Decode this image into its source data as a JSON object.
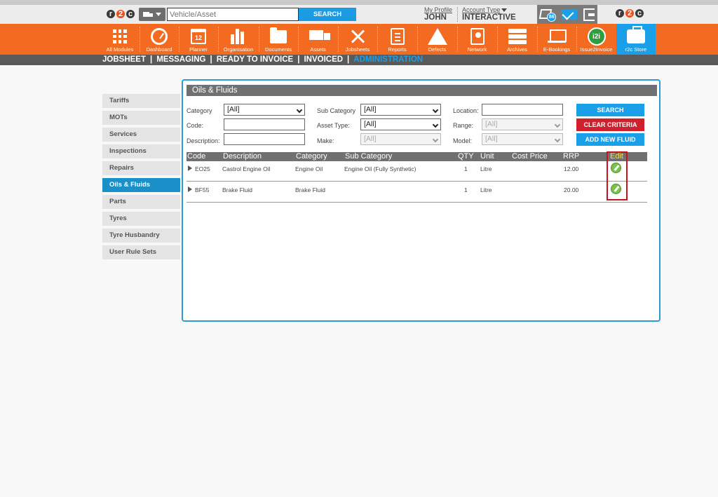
{
  "topbar": {
    "search_placeholder": "Vehicle/Asset",
    "search_button": "SEARCH",
    "my_profile_label": "My Profile",
    "user_name": "JOHN",
    "account_type_label": "Account Type",
    "account_type_value": "INTERACTIVE",
    "notification_count": "86",
    "logo_letters": [
      "r",
      "2",
      "c"
    ]
  },
  "nav": {
    "items": [
      {
        "label": "All Modules",
        "icon": "grid-icon"
      },
      {
        "label": "Dashboard",
        "icon": "speedometer-icon"
      },
      {
        "label": "Planner",
        "icon": "calendar-icon",
        "glyph_text": "12"
      },
      {
        "label": "Organisation",
        "icon": "building-icon"
      },
      {
        "label": "Documents",
        "icon": "folder-icon"
      },
      {
        "label": "Assets",
        "icon": "truck-icon"
      },
      {
        "label": "Jobsheets",
        "icon": "tools-icon"
      },
      {
        "label": "Reports",
        "icon": "clipboard-icon"
      },
      {
        "label": "Defects",
        "icon": "warning-icon"
      },
      {
        "label": "Network",
        "icon": "address-book-icon"
      },
      {
        "label": "Archives",
        "icon": "archive-icon"
      },
      {
        "label": "E-Bookings",
        "icon": "laptop-icon"
      },
      {
        "label": "Issue2Invoice",
        "icon": "i2i-icon",
        "glyph_text": "i2i"
      },
      {
        "label": "r2c Store",
        "icon": "briefcase-icon"
      }
    ]
  },
  "subnav": {
    "items": [
      "JOBSHEET",
      "MESSAGING",
      "READY TO INVOICE",
      "INVOICED",
      "ADMINISTRATION"
    ],
    "separator": "|",
    "active": "ADMINISTRATION"
  },
  "sidebar": {
    "items": [
      "Tariffs",
      "MOTs",
      "Services",
      "Inspections",
      "Repairs",
      "Oils & Fluids",
      "Parts",
      "Tyres",
      "Tyre Husbandry",
      "User Rule Sets"
    ],
    "active": "Oils & Fluids"
  },
  "panel": {
    "title": "Oils & Fluids",
    "filters": {
      "category_label": "Category",
      "category_value": "[All]",
      "sub_category_label": "Sub Category",
      "sub_category_value": "[All]",
      "location_label": "Location:",
      "code_label": "Code:",
      "asset_type_label": "Asset Type:",
      "asset_type_value": "[All]",
      "range_label": "Range:",
      "range_value": "[All]",
      "description_label": "Description:",
      "make_label": "Make:",
      "make_value": "[All]",
      "model_label": "Model:",
      "model_value": "[All]"
    },
    "buttons": {
      "search": "SEARCH",
      "clear": "CLEAR CRITERIA",
      "add": "ADD NEW FLUID"
    },
    "table": {
      "columns": [
        "Code",
        "Description",
        "Category",
        "Sub Category",
        "QTY",
        "Unit",
        "Cost Price",
        "RRP",
        "Edit"
      ],
      "rows": [
        {
          "code": "EO25",
          "description": "Castrol Engine Oil",
          "category": "Engine Oil",
          "sub_category": "Engine Oil (Fully Synthetic)",
          "qty": "1",
          "unit": "Litre",
          "cost_price": "",
          "rrp": "12.00"
        },
        {
          "code": "BF55",
          "description": "Brake Fluid",
          "category": "Brake Fluid",
          "sub_category": "",
          "qty": "1",
          "unit": "Litre",
          "cost_price": "",
          "rrp": "20.00"
        }
      ]
    }
  },
  "colors": {
    "nav_orange": "#f26b21",
    "accent_blue": "#1aa0e8",
    "clear_red": "#d0202e",
    "highlight_red": "#c8141e",
    "edit_green": "#7bc24b"
  }
}
